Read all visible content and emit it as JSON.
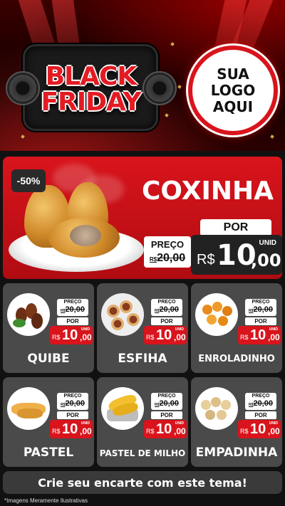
{
  "header": {
    "brand_line1": "BLACK",
    "brand_line2": "FRIDAY",
    "logo_line1": "SUA",
    "logo_line2": "LOGO",
    "logo_line3": "AQUI"
  },
  "featured": {
    "discount": "-50%",
    "name": "COXINHA",
    "old_label": "PREÇO",
    "old_currency": "R$",
    "old_price": "20,00",
    "por_label": "POR",
    "unit": "UNID",
    "currency": "R$",
    "price_int": "10",
    "price_cents": ",00"
  },
  "products": [
    {
      "name": "QUIBE",
      "old_label": "PREÇO",
      "old_currency": "R$",
      "old_price": "20,00",
      "por_label": "POR",
      "unit": "UNID",
      "currency": "R$",
      "price_int": "10",
      "price_cents": ",00"
    },
    {
      "name": "ESFIHA",
      "old_label": "PREÇO",
      "old_currency": "R$",
      "old_price": "20,00",
      "por_label": "POR",
      "unit": "UNID",
      "currency": "R$",
      "price_int": "10",
      "price_cents": ",00"
    },
    {
      "name": "ENROLADINHO",
      "old_label": "PREÇO",
      "old_currency": "R$",
      "old_price": "20,00",
      "por_label": "POR",
      "unit": "UNID",
      "currency": "R$",
      "price_int": "10",
      "price_cents": ",00"
    },
    {
      "name": "PASTEL",
      "old_label": "PREÇO",
      "old_currency": "R$",
      "old_price": "20,00",
      "por_label": "POR",
      "unit": "UNID",
      "currency": "R$",
      "price_int": "10",
      "price_cents": ",00"
    },
    {
      "name": "PASTEL DE MILHO",
      "old_label": "PREÇO",
      "old_currency": "R$",
      "old_price": "20,00",
      "por_label": "POR",
      "unit": "UNID",
      "currency": "R$",
      "price_int": "10",
      "price_cents": ",00"
    },
    {
      "name": "EMPADINHA",
      "old_label": "PREÇO",
      "old_currency": "R$",
      "old_price": "20,00",
      "por_label": "POR",
      "unit": "UNID",
      "currency": "R$",
      "price_int": "10",
      "price_cents": ",00"
    }
  ],
  "footer": {
    "cta": "Crie seu encarte com este tema!",
    "disclaimer": "*Imagens Meramente Ilustrativas"
  },
  "colors": {
    "accent_red": "#d9141c",
    "card_gray": "#4a4a4a",
    "dark": "#222222"
  }
}
